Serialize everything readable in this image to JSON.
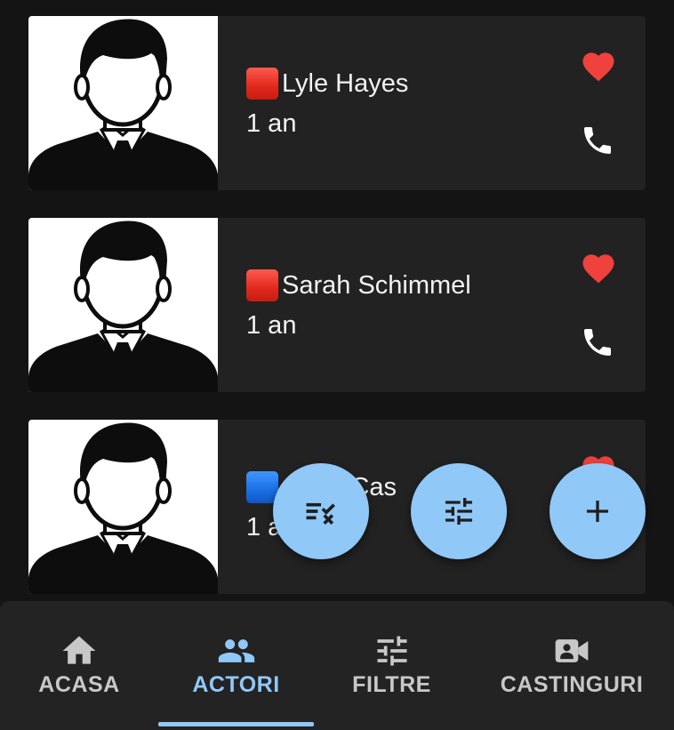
{
  "colors": {
    "background": "#141414",
    "card": "#222222",
    "accent": "#90c8f8",
    "heart": "#f0413c",
    "nav_inactive": "#c8c8c8"
  },
  "actors": [
    {
      "flag": "red-square",
      "name": "Lyle Hayes",
      "age": "1 an",
      "photo_icon": "person-suit-avatar-icon",
      "favorite_icon": "heart-icon",
      "call_icon": "phone-icon"
    },
    {
      "flag": "red-square",
      "name": "Sarah Schimmel",
      "age": "1 an",
      "photo_icon": "person-suit-avatar-icon",
      "favorite_icon": "heart-icon",
      "call_icon": "phone-icon"
    },
    {
      "flag": "blue-square",
      "name": "Chan Cas",
      "age": "1 a",
      "photo_icon": "person-suit-avatar-icon",
      "favorite_icon": "heart-icon",
      "call_icon": "phone-icon"
    }
  ],
  "fabs": [
    {
      "icon": "checklist-icon"
    },
    {
      "icon": "sliders-icon"
    },
    {
      "icon": "plus-icon"
    }
  ],
  "bottom_nav": {
    "items": [
      {
        "label": "ACASA",
        "icon": "home-icon",
        "active": false
      },
      {
        "label": "ACTORI",
        "icon": "people-icon",
        "active": true
      },
      {
        "label": "FILTRE",
        "icon": "sliders-icon",
        "active": false
      },
      {
        "label": "CASTINGURI",
        "icon": "video-camera-icon",
        "active": false
      }
    ]
  }
}
